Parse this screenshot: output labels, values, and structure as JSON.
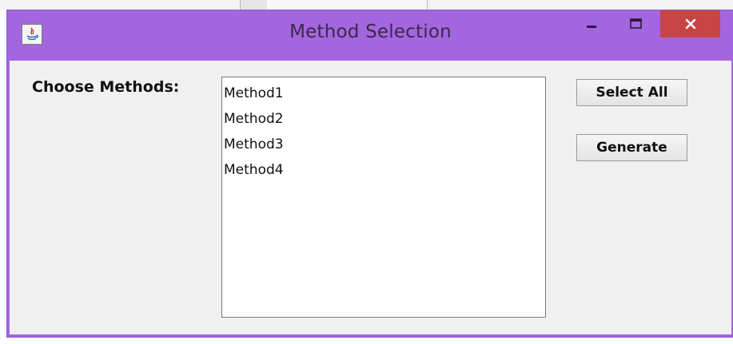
{
  "window": {
    "title": "Method Selection",
    "close_glyph": "✕",
    "colors": {
      "frame": "#a366df",
      "close": "#c74545",
      "client": "#f0f0f0"
    }
  },
  "panel": {
    "label": "Choose Methods:",
    "methods": [
      "Method1",
      "Method2",
      "Method3",
      "Method4"
    ]
  },
  "buttons": {
    "select_all": "Select All",
    "generate": "Generate"
  },
  "icons": {
    "app": "java-app-icon",
    "minimize": "minimize-icon",
    "maximize": "maximize-icon",
    "close": "close-icon"
  }
}
